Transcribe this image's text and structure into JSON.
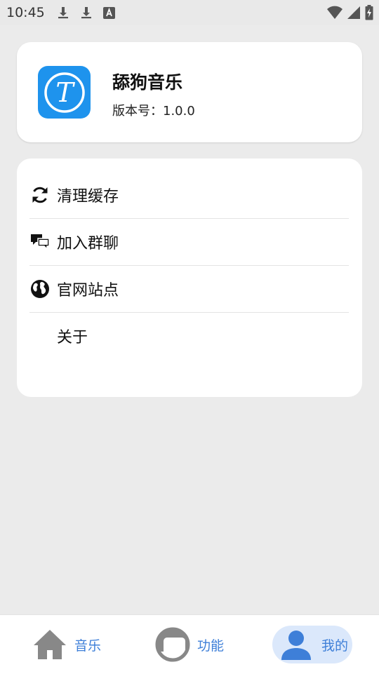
{
  "status_bar": {
    "time": "10:45",
    "left_icons": [
      "download-icon",
      "download-icon",
      "accessibility-a-icon"
    ],
    "right_icons": [
      "wifi-icon",
      "signal-icon",
      "battery-charging-icon"
    ]
  },
  "app_info": {
    "name": "舔狗音乐",
    "version": "版本号：1.0.0",
    "logo_letter": "T",
    "logo_color": "#1e93ed"
  },
  "menu": {
    "items": [
      {
        "label": "清理缓存",
        "icon": "refresh-icon"
      },
      {
        "label": "加入群聊",
        "icon": "chat-bubbles-icon"
      },
      {
        "label": "官网站点",
        "icon": "globe-icon"
      },
      {
        "label": "关于",
        "icon": ""
      }
    ]
  },
  "bottom_nav": {
    "items": [
      {
        "label": "音乐",
        "icon": "home-icon",
        "active": false
      },
      {
        "label": "功能",
        "icon": "half-circle-icon",
        "active": false
      },
      {
        "label": "我的",
        "icon": "person-icon",
        "active": true
      }
    ],
    "accent_color": "#3e7fd8",
    "active_bg": "#dbe8fb"
  }
}
